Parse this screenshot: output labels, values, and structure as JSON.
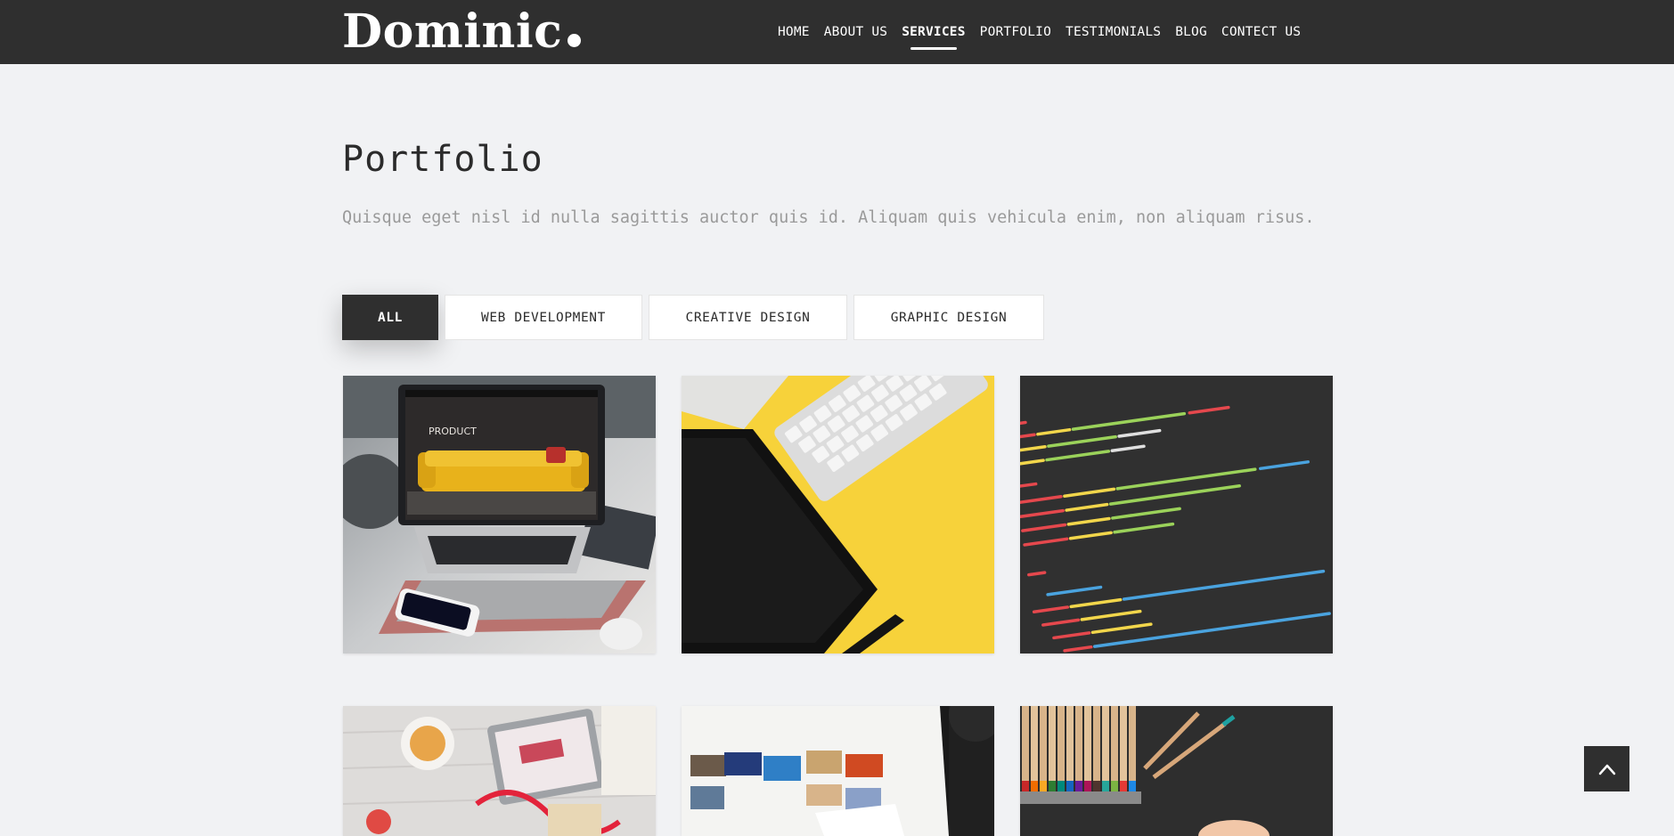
{
  "header": {
    "logo": "Dominic",
    "nav": [
      "HOME",
      "ABOUT US",
      "SERVICES",
      "PORTFOLIO",
      "TESTIMONIALS",
      "BLOG",
      "CONTECT US"
    ],
    "active_nav": "SERVICES"
  },
  "portfolio": {
    "title": "Portfolio",
    "subtitle": "Quisque eget nisl id nulla sagittis auctor quis id. Aliquam quis vehicula enim, non aliquam risus.",
    "filters": [
      "ALL",
      "WEB DEVELOPMENT",
      "CREATIVE DESIGN",
      "GRAPHIC DESIGN"
    ],
    "active_filter": "ALL"
  },
  "images": {
    "laptop_screen_text": "PRODUCT"
  },
  "colors": {
    "header_bg": "#2f2f2f",
    "page_bg": "#f1f2f4",
    "accent_yellow": "#f7d23a"
  },
  "icons": {
    "back_to_top": "chevron-up-icon"
  }
}
